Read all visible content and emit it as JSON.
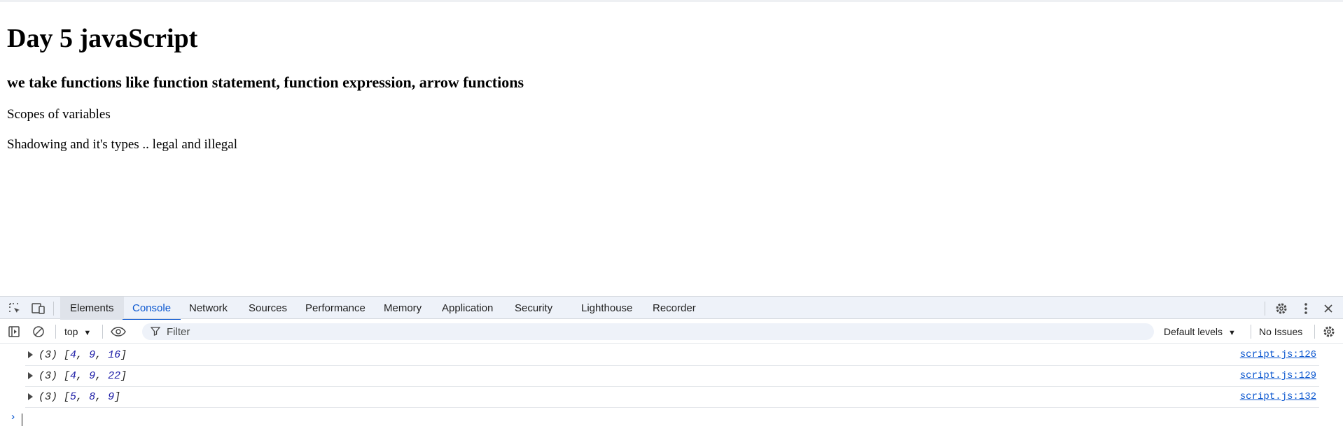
{
  "page": {
    "heading": "Day 5 javaScript",
    "subheading": "we take functions like function statement, function expression, arrow functions",
    "paragraphs": [
      "Scopes of variables",
      "Shadowing and it's types .. legal and illegal"
    ]
  },
  "devtools": {
    "tabs": [
      "Elements",
      "Console",
      "Network",
      "Sources",
      "Performance",
      "Memory",
      "Application",
      "Security",
      "Lighthouse",
      "Recorder"
    ],
    "active_tab": "Console",
    "toolbar": {
      "context": "top",
      "filter_placeholder": "Filter",
      "levels": "Default levels",
      "issues": "No Issues"
    },
    "console": {
      "entries": [
        {
          "count": "(3)",
          "values": [
            "4",
            "9",
            "16"
          ],
          "source": "script.js:126"
        },
        {
          "count": "(3)",
          "values": [
            "4",
            "9",
            "22"
          ],
          "source": "script.js:129"
        },
        {
          "count": "(3)",
          "values": [
            "5",
            "8",
            "9"
          ],
          "source": "script.js:132"
        }
      ],
      "prompt": "›"
    }
  },
  "icons": [
    "inspect-element-icon",
    "device-toolbar-icon",
    "settings-icon",
    "more-options-icon",
    "close-icon",
    "sidebar-toggle-icon",
    "clear-console-icon",
    "dropdown-icon",
    "eye-icon",
    "filter-icon"
  ],
  "colors": {
    "accent": "#0b57d0",
    "tabbar_bg": "#eef2f9",
    "number": "#1a1aa6"
  }
}
